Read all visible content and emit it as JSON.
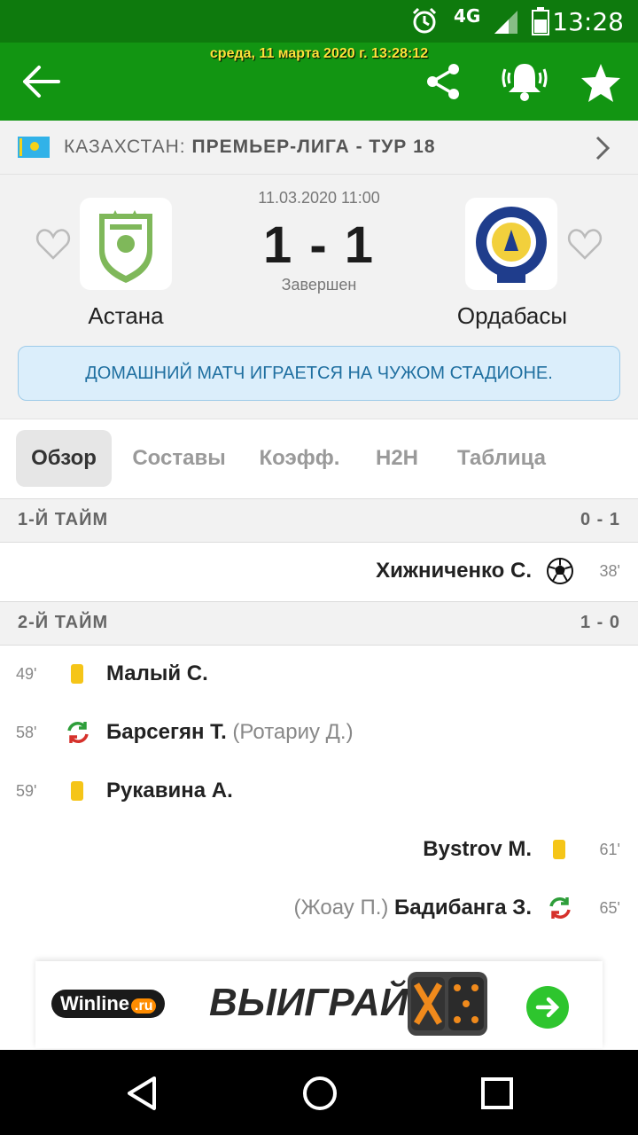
{
  "status_bar": {
    "time": "13:28",
    "network": "4G"
  },
  "app_bar": {
    "datetime": "среда, 11 марта 2020 г. 13:28:12"
  },
  "league": {
    "country": "КАЗАХСТАН:",
    "competition": "ПРЕМЬЕР-ЛИГА - ТУР 18"
  },
  "match": {
    "datetime": "11.03.2020 11:00",
    "score": "1 - 1",
    "status": "Завершен",
    "home_team": "Астана",
    "away_team": "Ордабасы",
    "notice": "ДОМАШНИЙ МАТЧ ИГРАЕТСЯ НА ЧУЖОМ СТАДИОНЕ."
  },
  "tabs": [
    "Обзор",
    "Составы",
    "Коэфф.",
    "H2H",
    "Таблица"
  ],
  "first_half": {
    "title": "1-Й ТАЙМ",
    "score": "0 - 1",
    "events": [
      {
        "minute": "38'",
        "side": "away",
        "type": "goal-icon",
        "player": "Хижниченко С."
      }
    ]
  },
  "second_half": {
    "title": "2-Й ТАЙМ",
    "score": "1 - 0",
    "events": [
      {
        "minute": "49'",
        "side": "home",
        "type": "yellow-card",
        "player": "Малый С."
      },
      {
        "minute": "58'",
        "side": "home",
        "type": "substitution-icon",
        "player": "Барсегян Т.",
        "sub": "(Ротариу Д.)"
      },
      {
        "minute": "59'",
        "side": "home",
        "type": "yellow-card",
        "player": "Рукавина А."
      },
      {
        "minute": "61'",
        "side": "away",
        "type": "yellow-card",
        "player": "Bystrov M."
      },
      {
        "minute": "65'",
        "side": "away",
        "type": "substitution-icon",
        "player": "Бадибанга З.",
        "sub": "(Жоау П.)"
      }
    ]
  },
  "ad": {
    "brand": "Winline",
    "brand_suffix": ".ru",
    "cta": "ВЫИГРАЙ"
  },
  "colors": {
    "status_bar": "#0e7a0d",
    "app_bar": "#129512",
    "accent_text": "#ffe23a",
    "card": "#f5c518"
  }
}
